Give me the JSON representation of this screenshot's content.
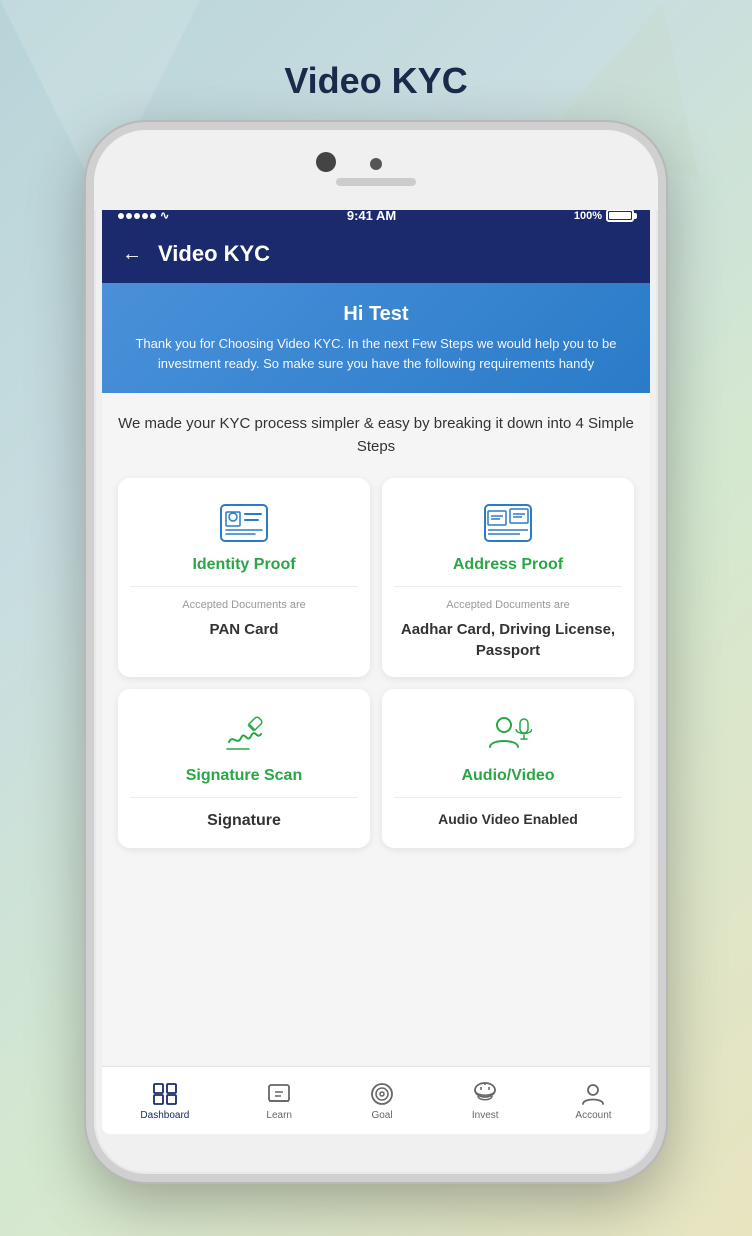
{
  "page": {
    "title": "Video KYC",
    "background_description": "gradient teal-green"
  },
  "status_bar": {
    "signal_dots": 5,
    "wifi": "wifi",
    "time": "9:41 AM",
    "battery": "100%"
  },
  "app_header": {
    "back_label": "←",
    "title": "Video KYC"
  },
  "welcome_banner": {
    "greeting": "Hi Test",
    "description": "Thank you for Choosing Video KYC. In the next Few Steps we would help you to be investment ready. So make sure you have the following requirements handy"
  },
  "kyc_subtitle": "We made your KYC process simpler & easy by breaking it down into 4 Simple Steps",
  "cards": [
    {
      "id": "identity-proof",
      "title": "Identity Proof",
      "doc_label": "Accepted Documents are",
      "doc_value": "PAN Card",
      "icon": "id-card"
    },
    {
      "id": "address-proof",
      "title": "Address Proof",
      "doc_label": "Accepted Documents are",
      "doc_value": "Aadhar Card, Driving License, Passport",
      "icon": "address-card"
    },
    {
      "id": "signature-scan",
      "title": "Signature Scan",
      "doc_label": "",
      "doc_value": "Signature",
      "icon": "signature"
    },
    {
      "id": "audio-video",
      "title": "Audio/Video",
      "doc_label": "",
      "doc_value": "Audio Video Enabled",
      "icon": "video"
    }
  ],
  "bottom_nav": [
    {
      "id": "dashboard",
      "label": "Dashboard",
      "icon": "grid",
      "active": true
    },
    {
      "id": "learn",
      "label": "Learn",
      "icon": "monitor",
      "active": false
    },
    {
      "id": "goal",
      "label": "Goal",
      "icon": "target",
      "active": false
    },
    {
      "id": "invest",
      "label": "Invest",
      "icon": "piggy",
      "active": false
    },
    {
      "id": "account",
      "label": "Account",
      "icon": "person",
      "active": false
    }
  ]
}
